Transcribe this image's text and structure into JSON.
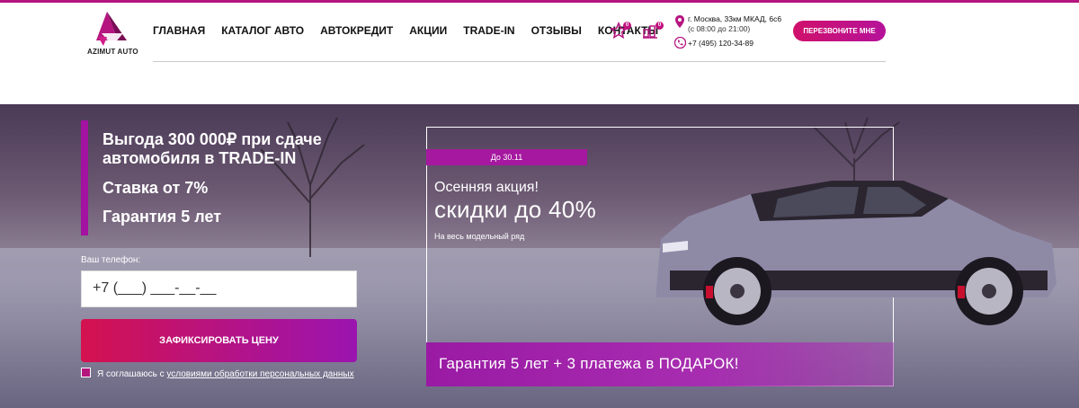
{
  "brand": {
    "logo_text": "AZIMUT AUTO",
    "accent": "#b5157f"
  },
  "nav": {
    "items": [
      "ГЛАВНАЯ",
      "КАТАЛОГ АВТО",
      "АВТОКРЕДИТ",
      "АКЦИИ",
      "TRADE-IN",
      "ОТЗЫВЫ",
      "КОНТАКТЫ"
    ]
  },
  "favorites": {
    "icon": "star-icon",
    "count": "0"
  },
  "compare": {
    "icon": "compare-icon",
    "count": "0"
  },
  "contacts": {
    "address": "г. Москва, 33км МКАД, 6с6",
    "hours": "(с 08:00 до 21:00)",
    "phone": "+7 (495) 120-34-89"
  },
  "callback_label": "ПЕРЕЗВОНИТЕ МНЕ",
  "offers": [
    "Выгода 300 000₽ при сдаче автомобиля в TRADE-IN",
    "Ставка от 7%",
    "Гарантия 5 лет"
  ],
  "form": {
    "phone_label": "Ваш телефон:",
    "phone_placeholder": "+7 (___) ___-__-__",
    "submit_label": "ЗАФИКСИРОВАТЬ ЦЕНУ",
    "consent_prefix": "Я соглашаюсь с ",
    "consent_link": "условиями обработки персональных данных"
  },
  "promo": {
    "date_tag": "До 30.11",
    "title": "Осенняя акция!",
    "headline": "скидки до 40%",
    "sub": "На весь модельный ряд",
    "gift": "Гарантия 5 лет + 3 платежа в ПОДАРОК!"
  }
}
